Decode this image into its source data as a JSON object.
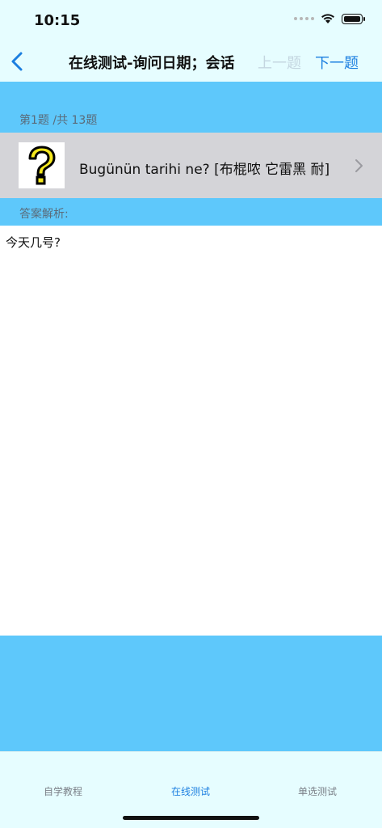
{
  "status": {
    "time": "10:15"
  },
  "nav": {
    "title": "在线测试-询问日期；会话",
    "prev_label": "上一题",
    "next_label": "下一题"
  },
  "question": {
    "counter": "第1题 /共 13题",
    "text": "Bugünün tarihi ne? [布棍哝 它雷黑 耐]",
    "image_icon": "question-mark-icon"
  },
  "analysis": {
    "label": "答案解析:",
    "answer": "今天几号?"
  },
  "tabs": [
    {
      "label": "自学教程",
      "active": false
    },
    {
      "label": "在线测试",
      "active": true
    },
    {
      "label": "单选测试",
      "active": false
    }
  ],
  "colors": {
    "accent": "#1c7fe0",
    "band": "#5ec8fb",
    "bar_bg": "#e6fdff",
    "row_bg": "#d4d4d8",
    "disabled": "#c4d6e0"
  }
}
